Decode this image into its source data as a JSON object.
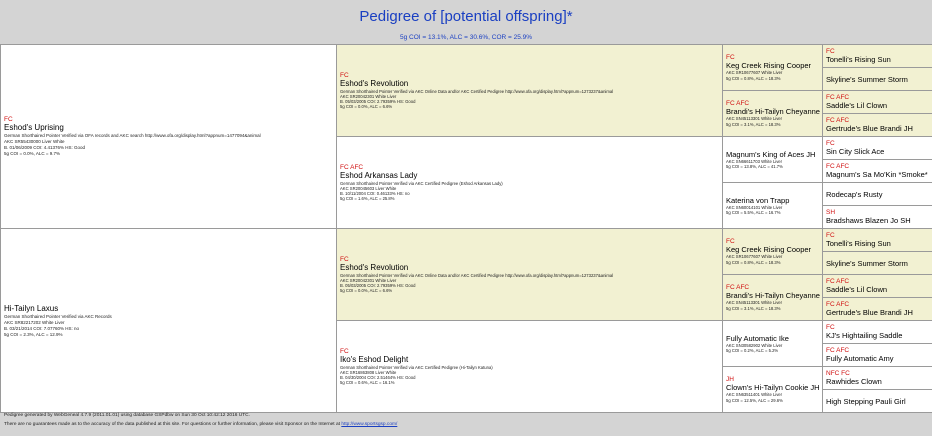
{
  "header": {
    "title": "Pedigree of [potential offspring]*",
    "subtitle": "5g COI = 13.1%, ALC = 30.6%, COR = 25.9%"
  },
  "gen1": [
    {
      "title": "FC",
      "name": "Eshod's Uprising",
      "lines": [
        "German Shorthaired Pointer Verified via OFA records and AKC search http://www.ofa.org/display.html?appnum=1477094&animal",
        "AKC SR55430000 Liver White",
        "B. 01/06/2009 COI: 4.41376% HS: Good",
        "5g COI = 0.0%, ALC = 9.7%"
      ]
    },
    {
      "title": "",
      "name": "Hi-Tailyn Laxus",
      "lines": [
        "German Shorthaired Pointer Verified via AKC Records",
        "AKC SR82217202 White Liver",
        "B. 03/21/2014 COI: 7.07760% HS: no",
        "5g COI = 2.3%, ALC = 12.9%"
      ]
    }
  ],
  "gen2": [
    {
      "title": "FC",
      "name": "Eshod's Revolution",
      "lines": [
        "German Shorthaired Pointer Verified via AKC Online Data and/or AKC Certified Pedigree http://www.ofa.org/display.html?appnum=1273237&animal",
        "AKC SR20042301 White Liver",
        "B. 05/03/2005 COI: 2.79359% HS: Good",
        "5g COI = 0.0%, ALC = 6.6%"
      ]
    },
    {
      "title": "FC AFC",
      "name": "Eshod Arkansas Lady",
      "lines": [
        "German Shorthaired Pointer Verified via AKC Certified Pedigree (Eshod Arkansas Lady)",
        "AKC SR20045603 Liver White",
        "B. 10/11/2004 COI: 0.46133% HS: no",
        "5g COI = 1.6%, ALC = 25.8%"
      ]
    },
    {
      "title": "FC",
      "name": "Eshod's Revolution",
      "lines": [
        "German Shorthaired Pointer Verified via AKC Online Data and/or AKC Certified Pedigree http://www.ofa.org/display.html?appnum=1273237&animal",
        "AKC SR20042301 White Liver",
        "B. 05/03/2005 COI: 2.79359% HS: Good",
        "5g COI = 0.0%, ALC = 6.6%"
      ]
    },
    {
      "title": "FC",
      "name": "Iko's Eshod Delight",
      "lines": [
        "German Shorthaired Pointer Verified via AKC Certified Pedigree (Hi-Tailyn Katuna)",
        "AKC SR16863808 Liver White",
        "B. 04/30/2004 COI: 2.51464% HS: Good",
        "5g COI = 0.6%, ALC = 16.1%"
      ]
    }
  ],
  "gen3": [
    {
      "title": "FC",
      "name": "Keg Creek Rising Cooper",
      "lines": [
        "AKC SR10677607 White Liver",
        "5g COI = 0.8%, ALC = 18.3%"
      ]
    },
    {
      "title": "FC AFC",
      "name": "Brandi's Hi-Tailyn Cheyanne",
      "lines": [
        "AKC SN45113301 White Liver",
        "5g COI = 3.1%, ALC = 18.3%"
      ]
    },
    {
      "title": "",
      "name": "Magnum's King of Aces JH",
      "lines": [
        "AKC SN66611703 White Liver",
        "5g COI = 13.8%, ALC = 41.7%"
      ]
    },
    {
      "title": "",
      "name": "Katerina von Trapp",
      "lines": [
        "AKC SN60014101 White Liver",
        "5g COI = 5.5%, ALC = 16.7%"
      ]
    },
    {
      "title": "FC",
      "name": "Keg Creek Rising Cooper",
      "lines": [
        "AKC SR10677607 White Liver",
        "5g COI = 0.8%, ALC = 18.3%"
      ]
    },
    {
      "title": "FC AFC",
      "name": "Brandi's Hi-Tailyn Cheyanne",
      "lines": [
        "AKC SN45113301 White Liver",
        "5g COI = 3.1%, ALC = 18.3%"
      ]
    },
    {
      "title": "",
      "name": "Fully Automatic Ike",
      "lines": [
        "AKC SN30582902 White Liver",
        "5g COI = 0.2%, ALC = 5.2%"
      ]
    },
    {
      "title": "JH",
      "name": "Clown's Hi-Tailyn Cookie JH",
      "lines": [
        "AKC SN63511401 White Liver",
        "5g COI = 12.5%, ALC = 29.6%"
      ]
    }
  ],
  "gen4": [
    {
      "title": "FC",
      "name": "Tonelli's Rising Sun"
    },
    {
      "title": "",
      "name": "Skyline's Summer Storm"
    },
    {
      "title": "FC AFC",
      "name": "Saddle's Lil Clown"
    },
    {
      "title": "FC AFC",
      "name": "Gertrude's Blue Brandi JH"
    },
    {
      "title": "FC",
      "name": "Sin City Slick Ace"
    },
    {
      "title": "FC AFC",
      "name": "Magnum's Sa Mo'Kin *Smoke*"
    },
    {
      "title": "",
      "name": "Rodecap's Rusty"
    },
    {
      "title": "SH",
      "name": "Bradshaws Blazen Jo SH"
    },
    {
      "title": "FC",
      "name": "Tonelli's Rising Sun"
    },
    {
      "title": "",
      "name": "Skyline's Summer Storm"
    },
    {
      "title": "FC AFC",
      "name": "Saddle's Lil Clown"
    },
    {
      "title": "FC AFC",
      "name": "Gertrude's Blue Brandi JH"
    },
    {
      "title": "FC",
      "name": "KJ's Hightailing Saddle"
    },
    {
      "title": "FC AFC",
      "name": "Fully Automatic Amy"
    },
    {
      "title": "NFC FC",
      "name": "Rawhides Clown"
    },
    {
      "title": "",
      "name": "High Stepping Pauli Girl"
    }
  ],
  "footer": {
    "line1": "Pedigree generated by WebGeneal 4.7.9 (2011.01.01) using database GSPdbw on Sun 30 Oct 10:42:12 2016 UTC.",
    "line2_prefix": "There are no guarantees made as to the accuracy of the data published at this site. For questions or further information, please visit Sponsor on the Internet at",
    "line2_link": "http://www.sportsgsp.com/"
  }
}
